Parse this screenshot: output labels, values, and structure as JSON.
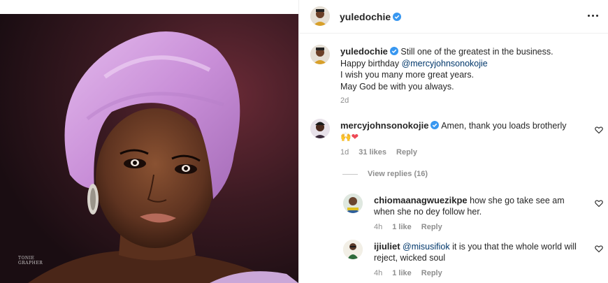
{
  "photo": {
    "alt_watermark_line1": "TONIE",
    "alt_watermark_line2": "GRAPHER"
  },
  "post": {
    "author": "yuledochie",
    "more_icon": "ellipsis-icon"
  },
  "caption": {
    "author": "yuledochie",
    "line1": "Still one of the greatest in the business.",
    "line2_prefix": "Happy birthday ",
    "line2_mention": "@mercyjohnsonokojie",
    "line3": "I wish you many more great years.",
    "line4": "May God be with you always.",
    "time": "2d"
  },
  "comments": [
    {
      "author": "mercyjohnsonokojie",
      "text": "Amen, thank you loads brotherly",
      "emoji": "🙌❤",
      "time": "1d",
      "likes": "31 likes",
      "reply": "Reply"
    }
  ],
  "view_replies": "View replies (16)",
  "replies": [
    {
      "author": "chiomaanagwuezikpe",
      "text_line1": "how she go take see am",
      "text_line2": "when she no dey follow her.",
      "time": "4h",
      "likes": "1 like",
      "reply": "Reply"
    },
    {
      "author": "ijiuliet",
      "mention": "@misusifiok",
      "text_line1": "it is you that the whole world will",
      "text_line2": "reject, wicked soul",
      "time": "4h",
      "likes": "1 like",
      "reply": "Reply"
    }
  ],
  "colors": {
    "verified": "#3897f0",
    "mention": "#00376b",
    "muted": "#8e8e8e",
    "heart_red": "#ed4956"
  }
}
